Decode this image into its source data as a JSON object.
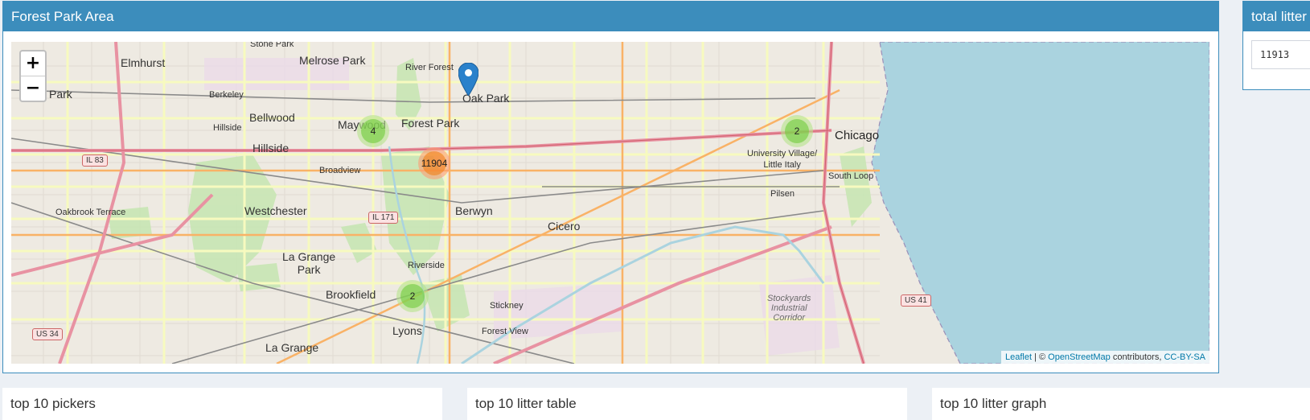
{
  "map_box": {
    "title": "Forest Park Area",
    "zoom_in": "+",
    "zoom_out": "−",
    "attribution": {
      "leaflet": "Leaflet",
      "sep": " | © ",
      "osm": "OpenStreetMap",
      "contributors": " contributors, ",
      "license": "CC-BY-SA"
    },
    "clusters": [
      {
        "count": "4",
        "size": "small"
      },
      {
        "count": "11904",
        "size": "large"
      },
      {
        "count": "2",
        "size": "small"
      },
      {
        "count": "2",
        "size": "small"
      }
    ],
    "places": {
      "elmhurst": "Elmhurst",
      "melrose_park": "Melrose Park",
      "stone_park": "Stone Park",
      "river_forest": "River Forest",
      "oak_park": "Oak Park",
      "villa_park": "illa Park",
      "berkeley": "Berkeley",
      "bellwood": "Bellwood",
      "maywood": "Maywood",
      "forest_park": "Forest Park",
      "hillside_small": "Hillside",
      "hillside": "Hillside",
      "broadview": "Broadview",
      "westchester": "Westchester",
      "berwyn": "Berwyn",
      "cicero": "Cicero",
      "oakbrook_terrace": "Oakbrook Terrace",
      "la_grange_park": "La Grange\nPark",
      "riverside": "Riverside",
      "brookfield": "Brookfield",
      "stickney": "Stickney",
      "lyons": "Lyons",
      "forest_view": "Forest View",
      "la_grange": "La Grange",
      "chicago": "Chicago",
      "university_village": "University Village/\nLittle Italy",
      "south_loop": "South Loop",
      "pilsen": "Pilsen",
      "stockyards": "Stockyards\nIndustrial\nCorridor"
    },
    "shields": {
      "il83": "IL 83",
      "il171": "IL 171",
      "us34": "US 34",
      "us41": "US 41"
    }
  },
  "total_box": {
    "title": "total litter",
    "value": "11913"
  },
  "panels": {
    "pickers": "top 10 pickers",
    "table": "top 10 litter table",
    "graph": "top 10 litter graph"
  },
  "colors": {
    "header": "#3c8dbc",
    "water": "#aad3df",
    "park": "#c8facc",
    "cluster_small": "#6ecc39",
    "cluster_large": "#f18017",
    "marker": "#2a81cb"
  }
}
